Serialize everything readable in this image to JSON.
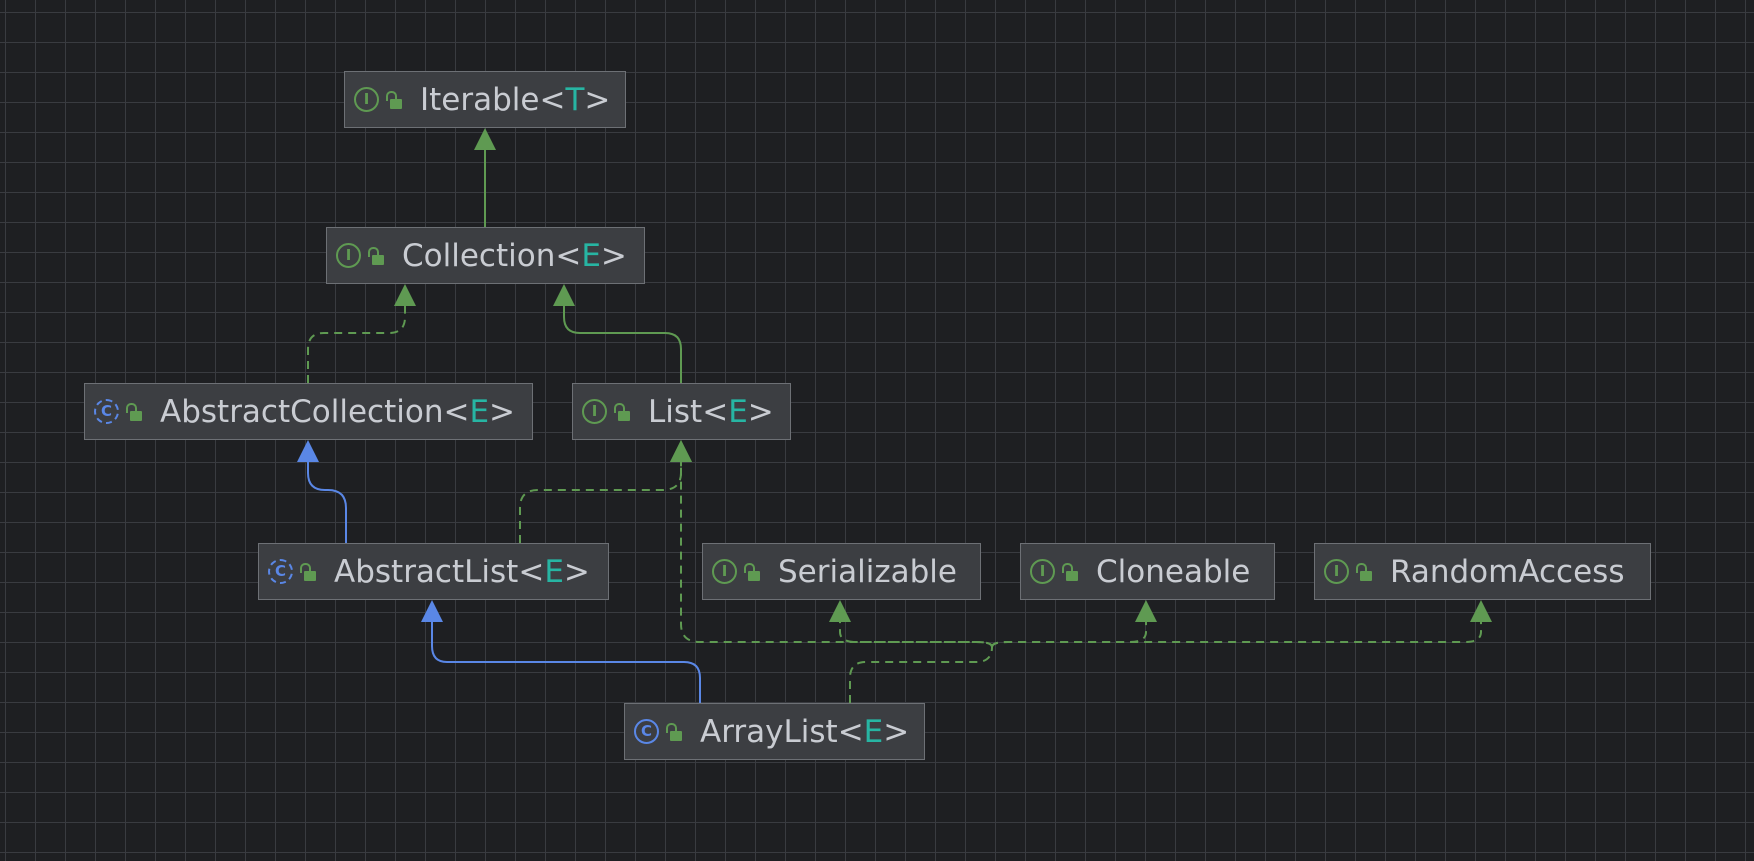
{
  "nodes": [
    {
      "id": "iterable",
      "kind": "interface",
      "kind_glyph": "I",
      "name": "Iterable",
      "type_param": "T"
    },
    {
      "id": "collection",
      "kind": "interface",
      "kind_glyph": "I",
      "name": "Collection",
      "type_param": "E"
    },
    {
      "id": "abstract-collection",
      "kind": "abstract-class",
      "kind_glyph": "C",
      "name": "AbstractCollection",
      "type_param": "E"
    },
    {
      "id": "list",
      "kind": "interface",
      "kind_glyph": "I",
      "name": "List",
      "type_param": "E"
    },
    {
      "id": "abstract-list",
      "kind": "abstract-class",
      "kind_glyph": "C",
      "name": "AbstractList",
      "type_param": "E"
    },
    {
      "id": "serializable",
      "kind": "interface",
      "kind_glyph": "I",
      "name": "Serializable",
      "type_param": ""
    },
    {
      "id": "cloneable",
      "kind": "interface",
      "kind_glyph": "I",
      "name": "Cloneable",
      "type_param": ""
    },
    {
      "id": "random-access",
      "kind": "interface",
      "kind_glyph": "I",
      "name": "RandomAccess",
      "type_param": ""
    },
    {
      "id": "array-list",
      "kind": "class",
      "kind_glyph": "C",
      "name": "ArrayList",
      "type_param": "E"
    }
  ],
  "edges": [
    {
      "from": "collection",
      "to": "iterable",
      "relation": "extends"
    },
    {
      "from": "abstract-collection",
      "to": "collection",
      "relation": "implements"
    },
    {
      "from": "list",
      "to": "collection",
      "relation": "extends"
    },
    {
      "from": "abstract-list",
      "to": "abstract-collection",
      "relation": "extends"
    },
    {
      "from": "abstract-list",
      "to": "list",
      "relation": "implements"
    },
    {
      "from": "array-list",
      "to": "abstract-list",
      "relation": "extends"
    },
    {
      "from": "array-list",
      "to": "list",
      "relation": "implements"
    },
    {
      "from": "array-list",
      "to": "serializable",
      "relation": "implements"
    },
    {
      "from": "array-list",
      "to": "cloneable",
      "relation": "implements"
    },
    {
      "from": "array-list",
      "to": "random-access",
      "relation": "implements"
    }
  ],
  "colors": {
    "background": "#1e1f22",
    "grid": "#393b40",
    "node_fill": "#3c3e42",
    "node_border": "#6d7075",
    "text": "#c9ccd2",
    "type_param": "#27b5a3",
    "interface_green": "#5f9a52",
    "class_blue": "#5a87e6"
  }
}
